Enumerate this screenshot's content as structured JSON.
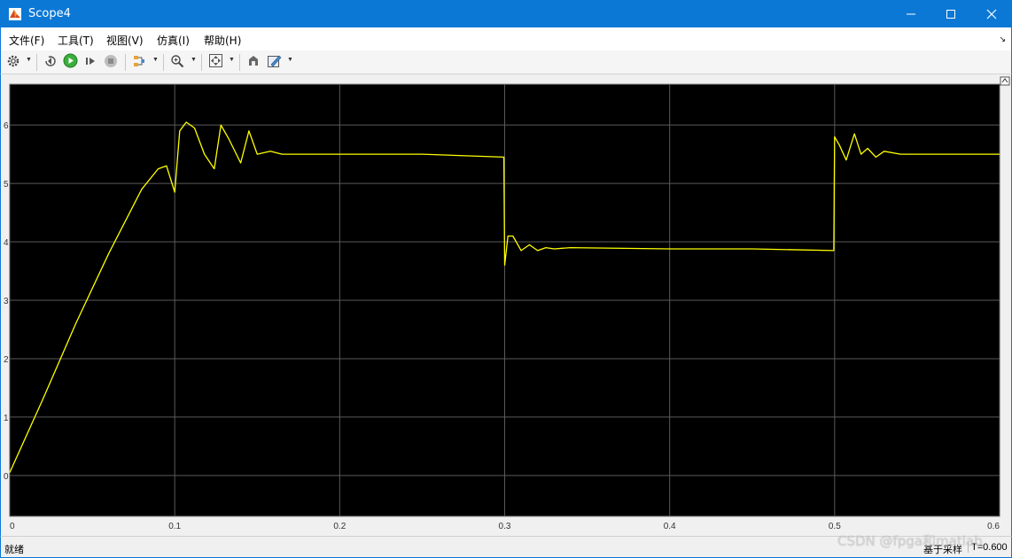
{
  "window": {
    "title": "Scope4",
    "accent": "#0b78d6"
  },
  "menu": [
    "文件(F)",
    "工具(T)",
    "视图(V)",
    "仿真(I)",
    "帮助(H)"
  ],
  "toolbar": {
    "icons": [
      "gear-icon",
      "step-back-icon",
      "run-icon",
      "step-forward-icon",
      "stop-icon",
      "highlight-icon",
      "zoom-in-icon",
      "autoscale-icon",
      "restore-icon",
      "style-icon"
    ]
  },
  "status": {
    "state": "就绪",
    "mode": "基于采样",
    "time": "T=0.600"
  },
  "watermark": "CSDN @fpga和matlab",
  "chart_data": {
    "type": "line",
    "background": "#000000",
    "grid": true,
    "line_color": "#ffff00",
    "xlim": [
      0,
      0.6
    ],
    "ylim": [
      -0.7,
      6.7
    ],
    "xticks": [
      0,
      0.1,
      0.2,
      0.3,
      0.4,
      0.5,
      0.6
    ],
    "xtick_labels": [
      "0",
      "0.1",
      "0.2",
      "0.3",
      "0.4",
      "0.5",
      "0.6"
    ],
    "yticks": [
      0,
      1,
      2,
      3,
      4,
      5,
      6
    ],
    "ytick_labels": [
      "0",
      "1",
      "2",
      "3",
      "4",
      "5",
      "6"
    ],
    "series": [
      {
        "x": [
          0,
          0.02,
          0.04,
          0.06,
          0.08,
          0.09,
          0.095,
          0.1,
          0.103,
          0.107,
          0.112,
          0.118,
          0.124,
          0.128,
          0.133,
          0.14,
          0.145,
          0.15,
          0.158,
          0.165,
          0.2,
          0.25,
          0.2995,
          0.3,
          0.302,
          0.305,
          0.31,
          0.315,
          0.32,
          0.325,
          0.33,
          0.34,
          0.4,
          0.45,
          0.4995,
          0.5,
          0.503,
          0.507,
          0.512,
          0.516,
          0.52,
          0.525,
          0.53,
          0.54,
          0.6
        ],
        "y": [
          0.05,
          1.3,
          2.6,
          3.8,
          4.9,
          5.25,
          5.3,
          4.85,
          5.9,
          6.05,
          5.95,
          5.5,
          5.25,
          6.0,
          5.75,
          5.35,
          5.9,
          5.5,
          5.55,
          5.5,
          5.5,
          5.5,
          5.45,
          3.6,
          4.1,
          4.1,
          3.85,
          3.95,
          3.85,
          3.9,
          3.88,
          3.9,
          3.88,
          3.88,
          3.85,
          5.8,
          5.65,
          5.4,
          5.85,
          5.5,
          5.6,
          5.45,
          5.55,
          5.5,
          5.5
        ]
      }
    ]
  }
}
